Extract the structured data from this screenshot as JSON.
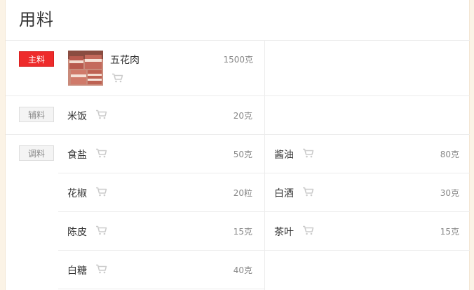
{
  "title": "用料",
  "sections": {
    "main": {
      "tag": "主料",
      "items": [
        {
          "name": "五花肉",
          "amount": "1500克",
          "image": "pork-belly-photo"
        }
      ]
    },
    "aux": {
      "tag": "辅料",
      "items": [
        {
          "name": "米饭",
          "amount": "20克"
        }
      ]
    },
    "seasoning": {
      "tag": "调料",
      "items": [
        {
          "name": "食盐",
          "amount": "50克"
        },
        {
          "name": "酱油",
          "amount": "80克"
        },
        {
          "name": "花椒",
          "amount": "20粒"
        },
        {
          "name": "白酒",
          "amount": "30克"
        },
        {
          "name": "陈皮",
          "amount": "15克"
        },
        {
          "name": "茶叶",
          "amount": "15克"
        },
        {
          "name": "白糖",
          "amount": "40克"
        }
      ]
    }
  },
  "icons": {
    "cart": "shopping-cart-icon"
  },
  "colors": {
    "main_tag": "#ee2b2b",
    "cart": "#cccccc",
    "background": "#fbf3e6"
  }
}
